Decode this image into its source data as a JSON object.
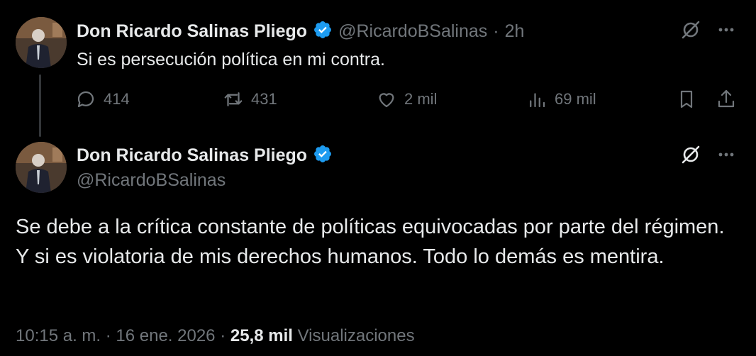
{
  "tweet1": {
    "author_name": "Don Ricardo Salinas Pliego",
    "handle": "@RicardoBSalinas",
    "separator": "·",
    "time": "2h",
    "text": "Si es persecución política en mi contra.",
    "replies": "414",
    "reposts": "431",
    "likes": "2 mil",
    "views": "69 mil"
  },
  "tweet2": {
    "author_name": "Don Ricardo Salinas Pliego",
    "handle": "@RicardoBSalinas",
    "text": "Se debe a la crítica constante de políticas equivocadas por parte del régimen. Y si es violatoria de mis derechos humanos. Todo lo demás es mentira.",
    "timestamp": "10:15 a. m. · 16 ene. 2026",
    "meta_separator": "·",
    "views_count": "25,8 mil",
    "views_label": "Visualizaciones"
  },
  "colors": {
    "background": "#000000",
    "text_primary": "#e7e9ea",
    "text_secondary": "#71767b",
    "verified_blue": "#1d9bf0",
    "thread_line": "#333639"
  },
  "icons": {
    "verified": "verified-badge-icon",
    "grok": "grok-icon",
    "more": "more-icon",
    "reply": "reply-icon",
    "repost": "repost-icon",
    "like": "like-icon",
    "views": "views-icon",
    "bookmark": "bookmark-icon",
    "share": "share-icon"
  }
}
